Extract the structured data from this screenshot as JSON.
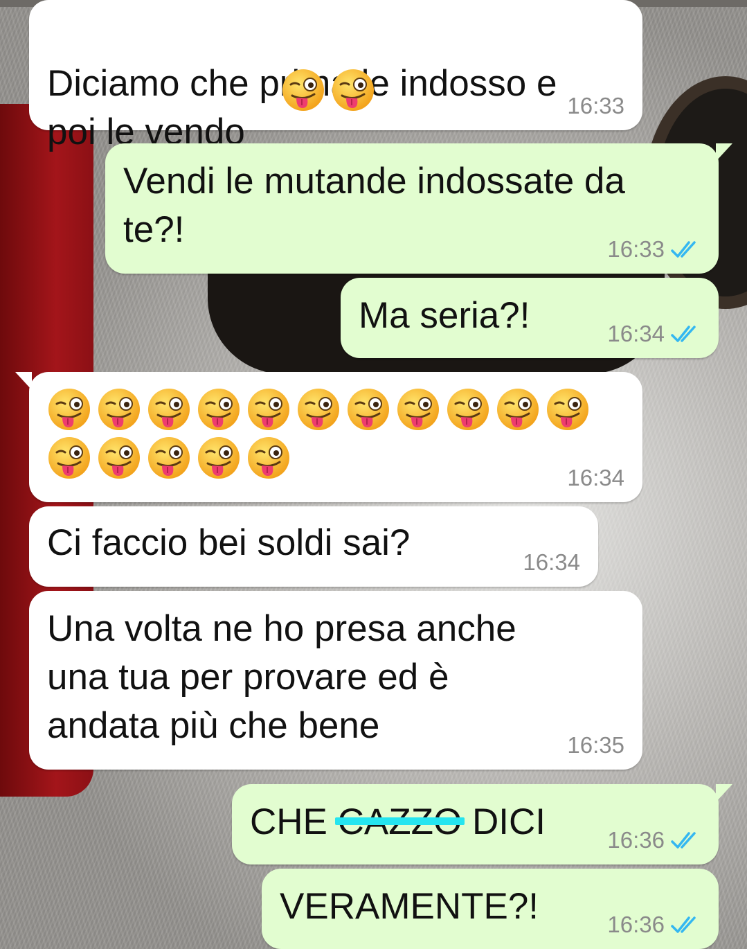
{
  "messages": [
    {
      "id": "m1",
      "direction": "incoming",
      "text": "Diciamo che prima le indosso e\npoi le vendo",
      "emoji_count": 2,
      "time": "16:33"
    },
    {
      "id": "m2",
      "direction": "outgoing",
      "text": "Vendi le mutande indossate da\nte?!",
      "time": "16:33",
      "status": "read"
    },
    {
      "id": "m3",
      "direction": "outgoing",
      "text": "Ma seria?!",
      "time": "16:34",
      "status": "read"
    },
    {
      "id": "m4",
      "direction": "incoming",
      "emoji_rows": [
        11,
        5
      ],
      "time": "16:34"
    },
    {
      "id": "m5",
      "direction": "incoming",
      "text": "Ci faccio bei soldi sai?",
      "time": "16:34"
    },
    {
      "id": "m6",
      "direction": "incoming",
      "text": "Una volta ne ho presa anche\nuna tua per provare ed è\nandata più che bene",
      "time": "16:35"
    },
    {
      "id": "m7",
      "direction": "outgoing",
      "text_before": "CHE ",
      "text_struck": "CAZZO",
      "text_after": " DICI",
      "time": "16:36",
      "status": "read"
    },
    {
      "id": "m8",
      "direction": "outgoing",
      "text": "VERAMENTE?!",
      "time": "16:36",
      "status": "read"
    }
  ],
  "icons": {
    "emoji": "winking-face-with-tongue-emoji",
    "read_receipt": "double-check-icon"
  },
  "colors": {
    "incoming_bg": "#ffffff",
    "outgoing_bg": "#e2fdd0",
    "read_tick": "#34b7f1",
    "strike_mark": "#25e5ef"
  }
}
